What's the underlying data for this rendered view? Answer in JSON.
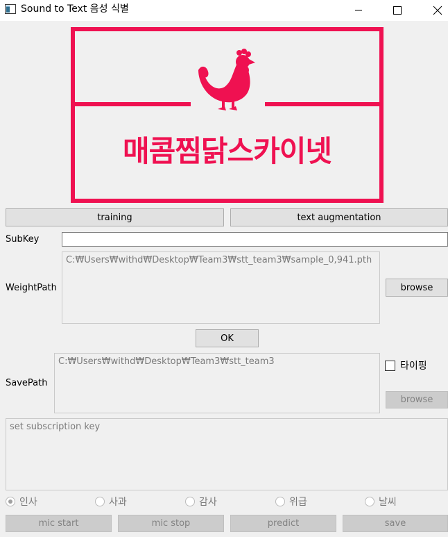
{
  "window": {
    "title": "Sound to Text 음성 식별",
    "minimize_icon": "minimize-icon",
    "maximize_icon": "maximize-icon",
    "close_icon": "close-icon"
  },
  "logo": {
    "icon": "chicken-icon",
    "text": "매콤찜닭스카이넷",
    "color": "#ef1151"
  },
  "tabs": {
    "training": "training",
    "text_augmentation": "text augmentation"
  },
  "subkey": {
    "label": "SubKey",
    "value": ""
  },
  "weight": {
    "label": "WeightPath",
    "value": "C:₩Users₩withd₩Desktop₩Team3₩stt_team3₩sample_0,941.pth",
    "browse": "browse"
  },
  "ok_button": "OK",
  "save": {
    "label": "SavePath",
    "value": "C:₩Users₩withd₩Desktop₩Team3₩stt_team3",
    "browse": "browse",
    "typing_label": "타이핑"
  },
  "log": {
    "text": "set subscription key"
  },
  "categories": [
    {
      "label": "인사",
      "checked": true
    },
    {
      "label": "사과",
      "checked": false
    },
    {
      "label": "감사",
      "checked": false
    },
    {
      "label": "위급",
      "checked": false
    },
    {
      "label": "날씨",
      "checked": false
    }
  ],
  "actions": {
    "mic_start": "mic start",
    "mic_stop": "mic stop",
    "predict": "predict",
    "save": "save"
  }
}
